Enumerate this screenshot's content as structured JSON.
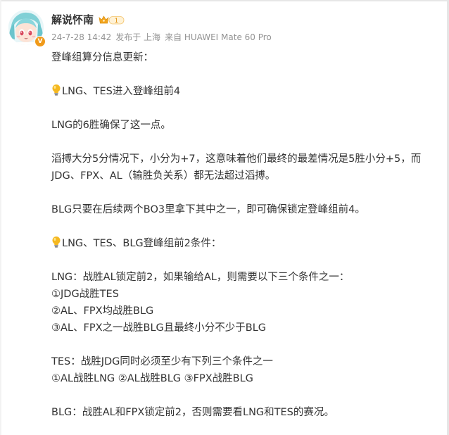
{
  "post": {
    "author": {
      "name": "解说怀南",
      "level": "1",
      "verified_mark": "V"
    },
    "meta": {
      "time": "24-7-28 14:42",
      "location": "发布于 上海",
      "device": "来自 HUAWEI Mate 60 Pro"
    },
    "lines": [
      "登峰组算分信息更新：",
      "LNG、TES进入登峰组前4",
      "LNG的6胜确保了这一点。",
      "滔搏大分5分情况下，小分为+7，这意味着他们最终的最差情况是5胜小分+5，而JDG、FPX、AL（输胜负关系）都无法超过滔搏。",
      "BLG只要在后续两个BO3里拿下其中之一，即可确保锁定登峰组前4。",
      "LNG、TES、BLG登峰组前2条件：",
      "LNG：战胜AL锁定前2，如果输给AL，则需要以下三个条件之一：",
      "①JDG战胜TES",
      "②AL、FPX均战胜BLG",
      "③AL、FPX之一战胜BLG且最终小分不少于BLG",
      "TES：战胜JDG同时必须至少有下列三个条件之一",
      "①AL战胜LNG ②AL战胜BLG ③FPX战胜BLG",
      "BLG：战胜AL和FPX锁定前2，否则需要看LNG和TES的赛况。"
    ]
  },
  "icons": {
    "bulb": "lightbulb-icon",
    "level": "crown-level-icon",
    "verified": "verified-badge-icon"
  },
  "colors": {
    "text": "#333333",
    "meta": "#939393",
    "badge": "#f09a1a",
    "bulb": "#f5b820"
  }
}
